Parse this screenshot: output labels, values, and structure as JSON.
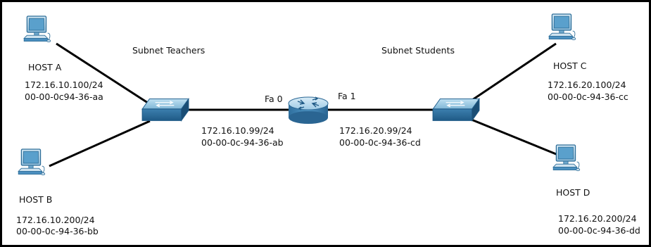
{
  "subnets": {
    "teachers_label": "Subnet Teachers",
    "students_label": "Subnet Students"
  },
  "hosts": {
    "a": {
      "name": "HOST A",
      "ip": "172.16.10.100/24",
      "mac": "00-00-0c94-36-aa"
    },
    "b": {
      "name": "HOST B",
      "ip": "172.16.10.200/24",
      "mac": "00-00-0c-94-36-bb"
    },
    "c": {
      "name": "HOST C",
      "ip": "172.16.20.100/24",
      "mac": "00-00-0c-94-36-cc"
    },
    "d": {
      "name": "HOST D",
      "ip": "172.16.20.200/24",
      "mac": "00-00-0c-94-36-dd"
    }
  },
  "router": {
    "fa0": {
      "label": "Fa 0",
      "ip": "172.16.10.99/24",
      "mac": "00-00-0c-94-36-ab"
    },
    "fa1": {
      "label": "Fa 1",
      "ip": "172.16.20.99/24",
      "mac": "00-00-0c-94-36-cd"
    }
  },
  "icons": {
    "host": "desktop-computer-icon",
    "switch": "network-switch-icon",
    "router": "router-icon"
  },
  "colors": {
    "link": "#000000",
    "device_blue": "#3f87b6",
    "screen": "#5aa0cc",
    "frame": "#000000"
  }
}
